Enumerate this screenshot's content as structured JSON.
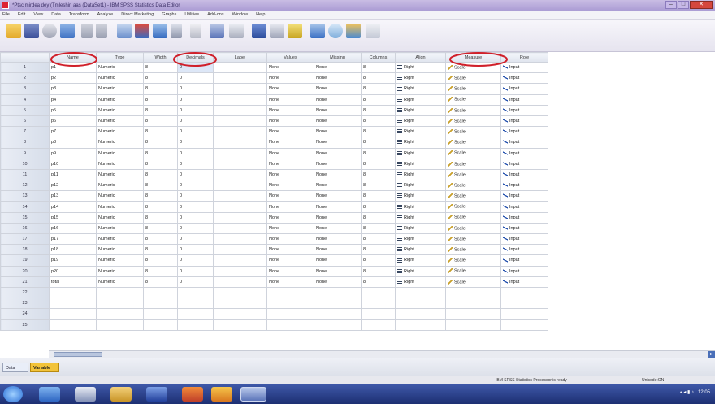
{
  "window": {
    "title": "*Ptsc mirdea dey (Tmleshin aas (DataSet1) - IBM SPSS Statistics Data Editor",
    "buttons": [
      "–",
      "□",
      "✕"
    ]
  },
  "menu": [
    "File",
    "Edit",
    "View",
    "Data",
    "Transform",
    "Analyze",
    "Direct Marketing",
    "Graphs",
    "Utilities",
    "Add-ons",
    "Window",
    "Help"
  ],
  "columns": [
    "",
    "Name",
    "Type",
    "Width",
    "Decimals",
    "Label",
    "Values",
    "Missing",
    "Columns",
    "Align",
    "Measure",
    "Role"
  ],
  "rows": [
    {
      "n": "1",
      "name": "p1",
      "type": "Numeric",
      "width": "8",
      "dec": "0",
      "values": "None",
      "missing": "None",
      "cols": "8",
      "align": "Right",
      "measure": "Scale",
      "role": "Input"
    },
    {
      "n": "2",
      "name": "p2",
      "type": "Numeric",
      "width": "8",
      "dec": "0",
      "values": "None",
      "missing": "None",
      "cols": "8",
      "align": "Right",
      "measure": "Scale",
      "role": "Input"
    },
    {
      "n": "3",
      "name": "p3",
      "type": "Numeric",
      "width": "8",
      "dec": "0",
      "values": "None",
      "missing": "None",
      "cols": "8",
      "align": "Right",
      "measure": "Scale",
      "role": "Input"
    },
    {
      "n": "4",
      "name": "p4",
      "type": "Numeric",
      "width": "8",
      "dec": "0",
      "values": "None",
      "missing": "None",
      "cols": "8",
      "align": "Right",
      "measure": "Scale",
      "role": "Input"
    },
    {
      "n": "5",
      "name": "p5",
      "type": "Numeric",
      "width": "8",
      "dec": "0",
      "values": "None",
      "missing": "None",
      "cols": "8",
      "align": "Right",
      "measure": "Scale",
      "role": "Input"
    },
    {
      "n": "6",
      "name": "p6",
      "type": "Numeric",
      "width": "8",
      "dec": "0",
      "values": "None",
      "missing": "None",
      "cols": "8",
      "align": "Right",
      "measure": "Scale",
      "role": "Input"
    },
    {
      "n": "7",
      "name": "p7",
      "type": "Numeric",
      "width": "8",
      "dec": "0",
      "values": "None",
      "missing": "None",
      "cols": "8",
      "align": "Right",
      "measure": "Scale",
      "role": "Input"
    },
    {
      "n": "8",
      "name": "p8",
      "type": "Numeric",
      "width": "8",
      "dec": "0",
      "values": "None",
      "missing": "None",
      "cols": "8",
      "align": "Right",
      "measure": "Scale",
      "role": "Input"
    },
    {
      "n": "9",
      "name": "p9",
      "type": "Numeric",
      "width": "8",
      "dec": "0",
      "values": "None",
      "missing": "None",
      "cols": "8",
      "align": "Right",
      "measure": "Scale",
      "role": "Input"
    },
    {
      "n": "10",
      "name": "p10",
      "type": "Numeric",
      "width": "8",
      "dec": "0",
      "values": "None",
      "missing": "None",
      "cols": "8",
      "align": "Right",
      "measure": "Scale",
      "role": "Input"
    },
    {
      "n": "11",
      "name": "p11",
      "type": "Numeric",
      "width": "8",
      "dec": "0",
      "values": "None",
      "missing": "None",
      "cols": "8",
      "align": "Right",
      "measure": "Scale",
      "role": "Input"
    },
    {
      "n": "12",
      "name": "p12",
      "type": "Numeric",
      "width": "8",
      "dec": "0",
      "values": "None",
      "missing": "None",
      "cols": "8",
      "align": "Right",
      "measure": "Scale",
      "role": "Input"
    },
    {
      "n": "13",
      "name": "p13",
      "type": "Numeric",
      "width": "8",
      "dec": "0",
      "values": "None",
      "missing": "None",
      "cols": "8",
      "align": "Right",
      "measure": "Scale",
      "role": "Input"
    },
    {
      "n": "14",
      "name": "p14",
      "type": "Numeric",
      "width": "8",
      "dec": "0",
      "values": "None",
      "missing": "None",
      "cols": "8",
      "align": "Right",
      "measure": "Scale",
      "role": "Input"
    },
    {
      "n": "15",
      "name": "p15",
      "type": "Numeric",
      "width": "8",
      "dec": "0",
      "values": "None",
      "missing": "None",
      "cols": "8",
      "align": "Right",
      "measure": "Scale",
      "role": "Input"
    },
    {
      "n": "16",
      "name": "p16",
      "type": "Numeric",
      "width": "8",
      "dec": "0",
      "values": "None",
      "missing": "None",
      "cols": "8",
      "align": "Right",
      "measure": "Scale",
      "role": "Input"
    },
    {
      "n": "17",
      "name": "p17",
      "type": "Numeric",
      "width": "8",
      "dec": "0",
      "values": "None",
      "missing": "None",
      "cols": "8",
      "align": "Right",
      "measure": "Scale",
      "role": "Input"
    },
    {
      "n": "18",
      "name": "p18",
      "type": "Numeric",
      "width": "8",
      "dec": "0",
      "values": "None",
      "missing": "None",
      "cols": "8",
      "align": "Right",
      "measure": "Scale",
      "role": "Input"
    },
    {
      "n": "19",
      "name": "p19",
      "type": "Numeric",
      "width": "8",
      "dec": "0",
      "values": "None",
      "missing": "None",
      "cols": "8",
      "align": "Right",
      "measure": "Scale",
      "role": "Input"
    },
    {
      "n": "20",
      "name": "p20",
      "type": "Numeric",
      "width": "8",
      "dec": "0",
      "values": "None",
      "missing": "None",
      "cols": "8",
      "align": "Right",
      "measure": "Scale",
      "role": "Input"
    },
    {
      "n": "21",
      "name": "total",
      "type": "Numeric",
      "width": "8",
      "dec": "0",
      "values": "None",
      "missing": "None",
      "cols": "8",
      "align": "Right",
      "measure": "Scale",
      "role": "Input"
    }
  ],
  "empty_rows": [
    "22",
    "23",
    "24",
    "25"
  ],
  "tabs": {
    "data_view": "Data View",
    "variable_view": "Variable View"
  },
  "status": {
    "processor": "IBM SPSS Statistics Processor is ready",
    "unicode": "Unicode:ON"
  },
  "taskbar": {
    "clock": "12:05"
  },
  "colors": {
    "title_bar": "#b3a6da",
    "annotation": "#d0202a",
    "active_tab": "#f2c33a",
    "taskbar": "#2a3f8c"
  }
}
